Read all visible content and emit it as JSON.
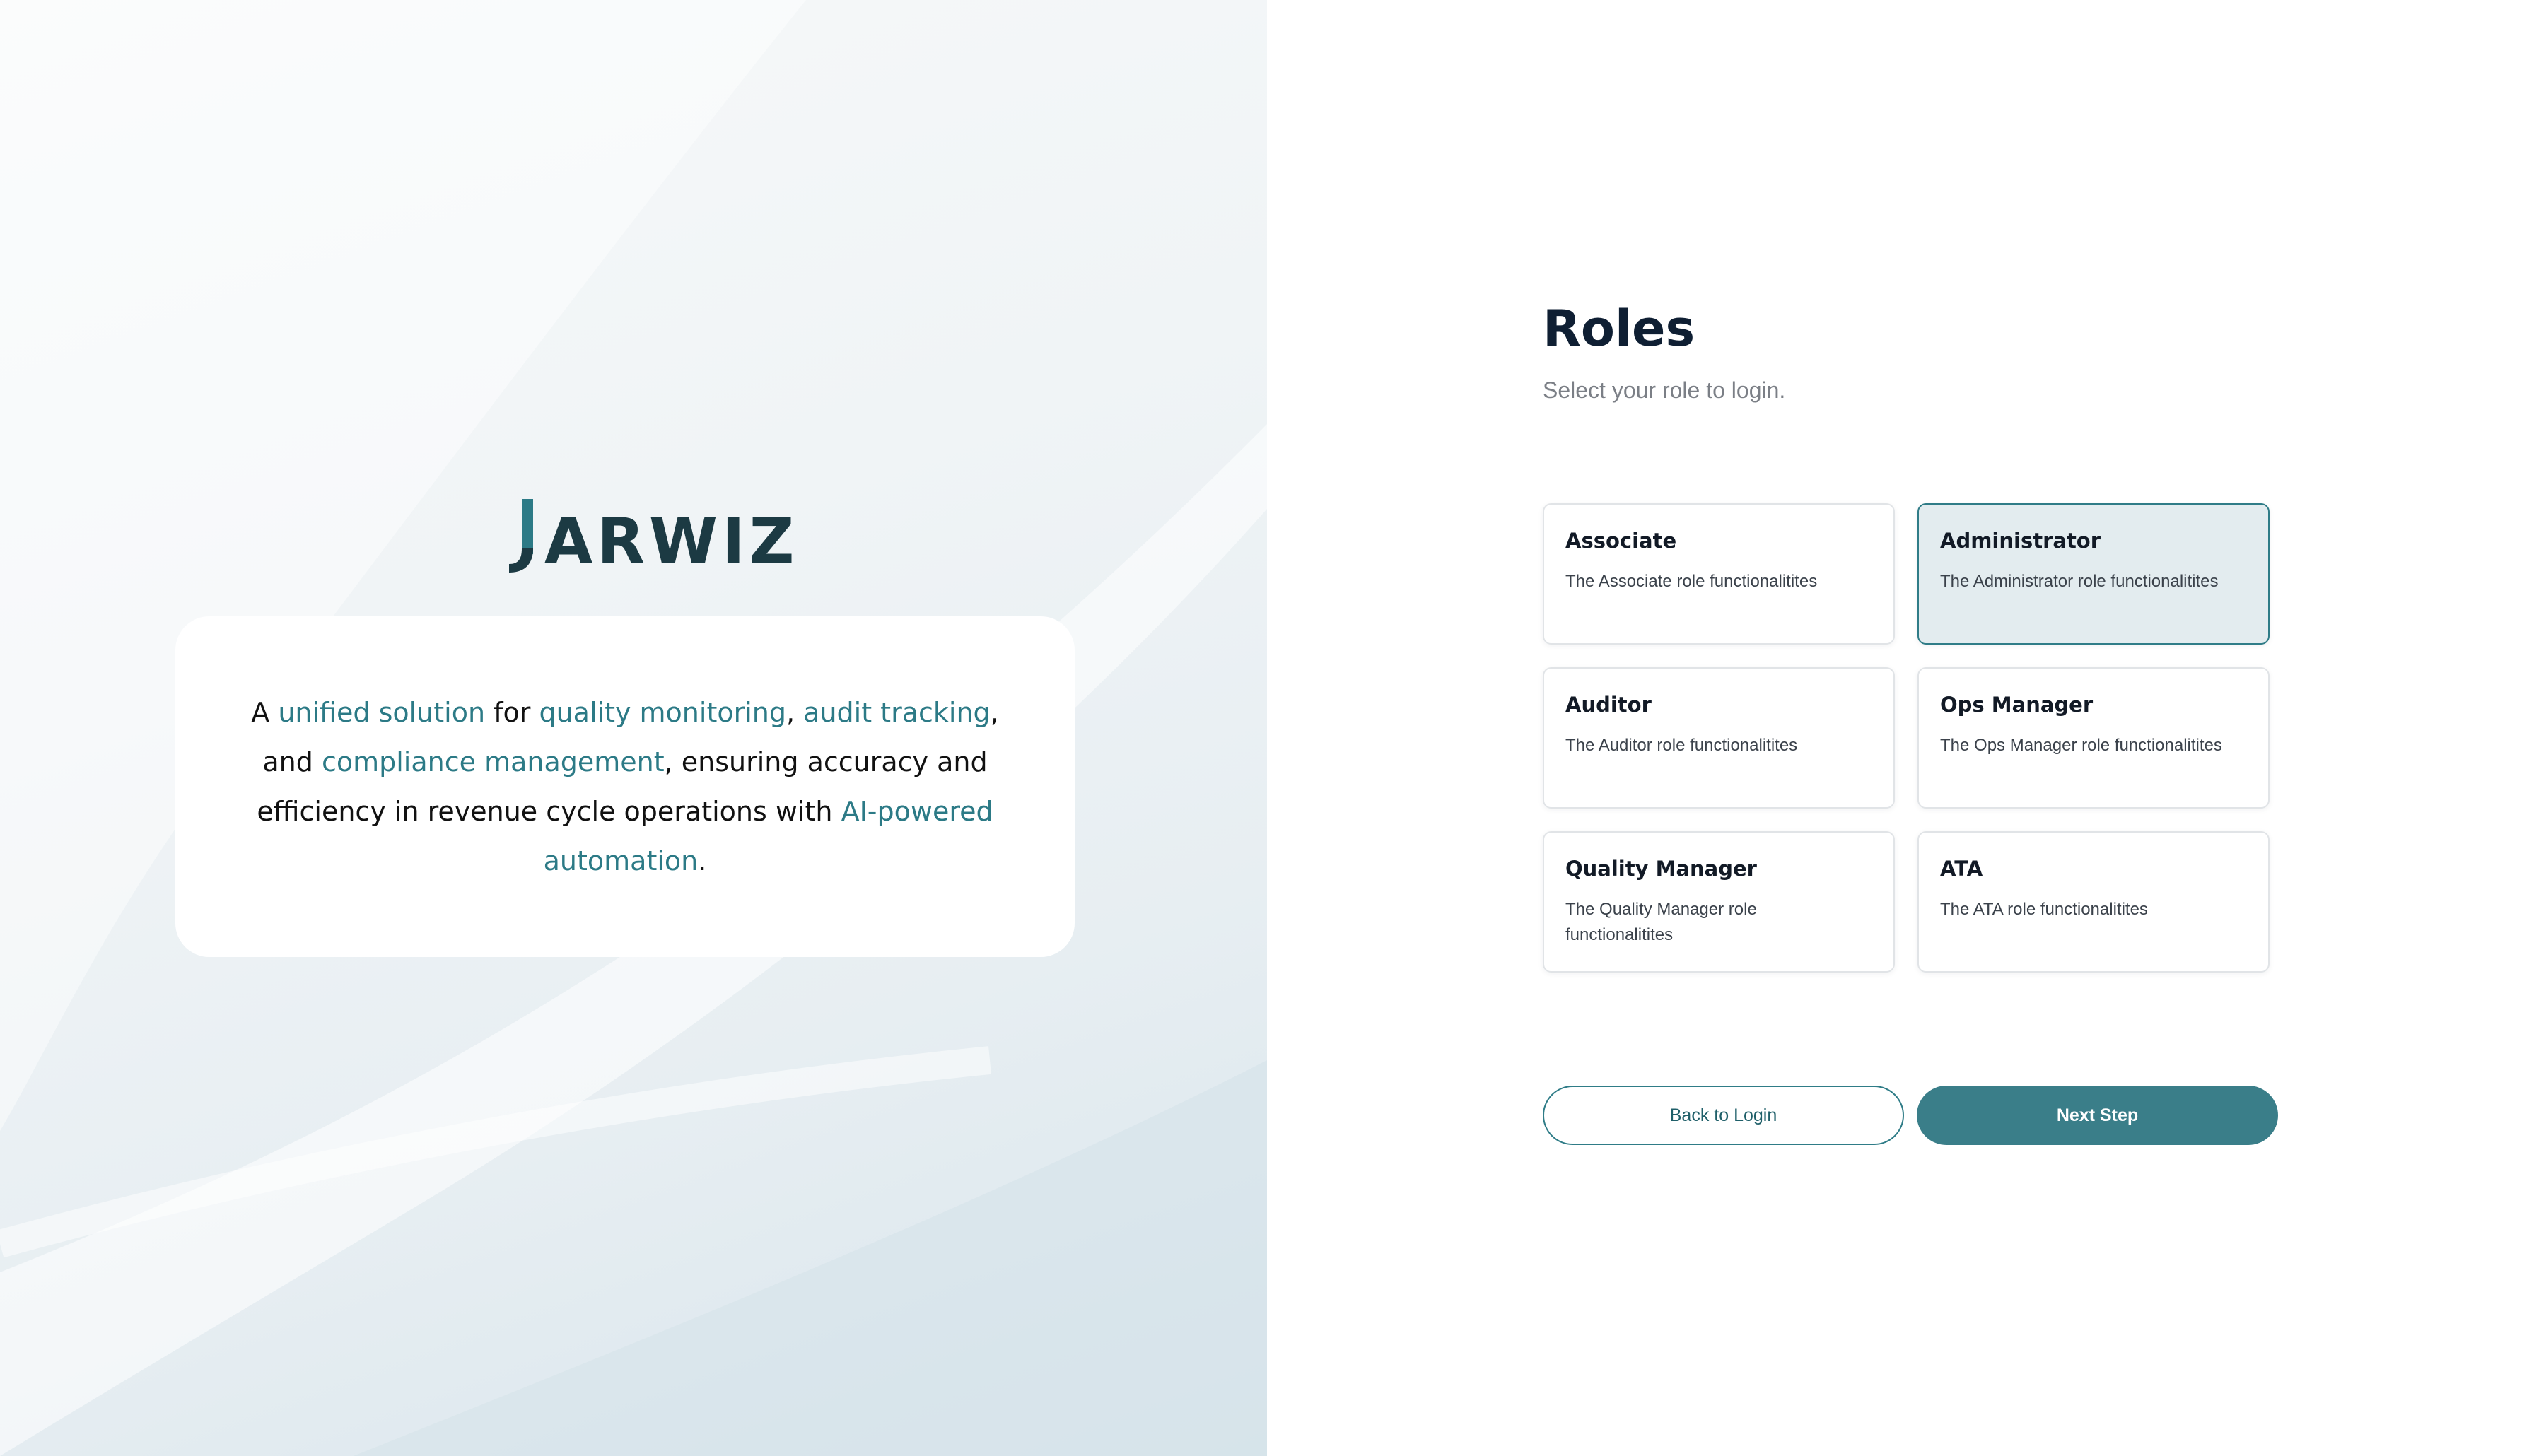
{
  "brand": {
    "logo_text": "JARWIZ",
    "logo_color": "#1c3a43",
    "accent_color": "#2c7a86"
  },
  "tagline": {
    "p1": "A ",
    "h1": "unified solution",
    "p2": " for ",
    "h2": "quality monitoring",
    "p3": ", ",
    "h3": "audit tracking",
    "p4": ", and ",
    "h4": "compliance management",
    "p5": ", ensuring accuracy and efficiency in revenue cycle operations with ",
    "h5": "AI-powered automation",
    "p6": "."
  },
  "roles_page": {
    "title": "Roles",
    "subtitle": "Select your role to login.",
    "selected_role": "Administrator",
    "roles": [
      {
        "name": "Associate",
        "description": "The Associate role functionalitites"
      },
      {
        "name": "Administrator",
        "description": "The Administrator role functionalitites"
      },
      {
        "name": "Auditor",
        "description": "The Auditor role functionalitites"
      },
      {
        "name": "Ops Manager",
        "description": "The Ops Manager role functionalitites"
      },
      {
        "name": "Quality Manager",
        "description": "The Quality Manager role functionalitites"
      },
      {
        "name": "ATA",
        "description": "The ATA role functionalitites"
      }
    ]
  },
  "actions": {
    "back_label": "Back to Login",
    "next_label": "Next Step",
    "primary_color": "#3a7e89"
  }
}
